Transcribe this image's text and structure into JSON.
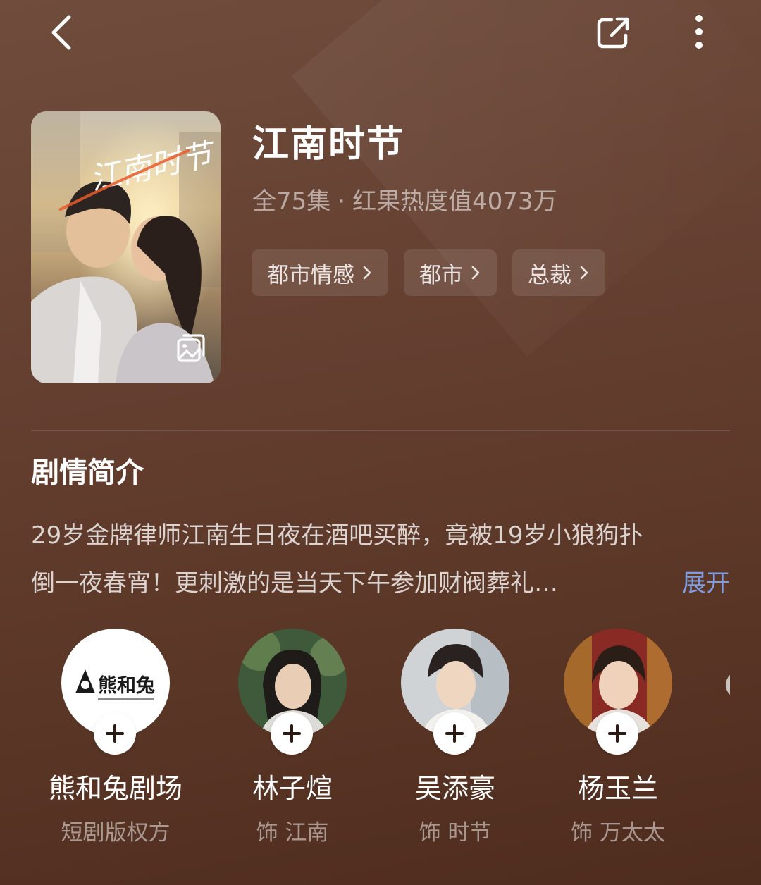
{
  "header": {
    "back_icon": "back-arrow-icon",
    "share_icon": "share-icon",
    "more_icon": "more-vertical-icon"
  },
  "drama": {
    "title": "江南时节",
    "episodes": "全75集",
    "separator": "·",
    "heat": "红果热度值4073万",
    "poster_gallery_icon": "gallery-icon",
    "tags": [
      {
        "label": "都市情感"
      },
      {
        "label": "都市"
      },
      {
        "label": "总裁"
      }
    ]
  },
  "synopsis": {
    "title": "剧情简介",
    "line1": "29岁金牌律师江南生日夜在酒吧买醉，竟被19岁小狼狗扑",
    "line2": "倒一夜春宵！更刺激的是当天下午参加财阀葬礼…",
    "expand_label": "展开"
  },
  "cast": [
    {
      "name": "熊和兔剧场",
      "role": "短剧版权方",
      "logo_text": "熊和兔"
    },
    {
      "name": "林子煊",
      "role": "饰 江南"
    },
    {
      "name": "吴添豪",
      "role": "饰 时节"
    },
    {
      "name": "杨玉兰",
      "role": "饰 万太太"
    }
  ],
  "colors": {
    "background": "#643f30",
    "expand_link": "#7e9de4",
    "tag_bg": "rgba(255,255,255,0.10)"
  }
}
